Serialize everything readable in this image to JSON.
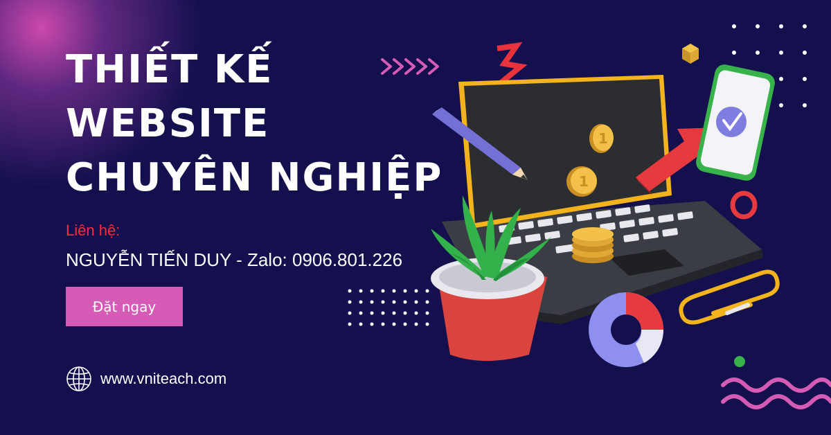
{
  "headline": {
    "line1": "THIẾT KẾ",
    "line2": "WEBSITE",
    "line3": "CHUYÊN NGHIỆP"
  },
  "contact": {
    "label": "Liên hệ:",
    "line": "NGUYỄN TIẾN DUY - Zalo: 0906.801.226"
  },
  "cta": {
    "label": "Đặt ngay"
  },
  "website": {
    "url": "www.vniteach.com",
    "icon": "globe-icon"
  },
  "colors": {
    "background": "#14104e",
    "accent_pink": "#d65bb6",
    "accent_red": "#ff2a3d",
    "text": "#ffffff"
  },
  "illustration": {
    "description_icons": [
      "laptop-icon",
      "pencil-icon",
      "coin-icon",
      "phone-check-icon",
      "arrow-up-icon",
      "plant-pot-icon",
      "donut-chart-icon",
      "paperclip-icon",
      "zigzag-icon",
      "chevrons-icon",
      "dot-grid-icon",
      "wave-icon"
    ],
    "coin_label": "1"
  }
}
